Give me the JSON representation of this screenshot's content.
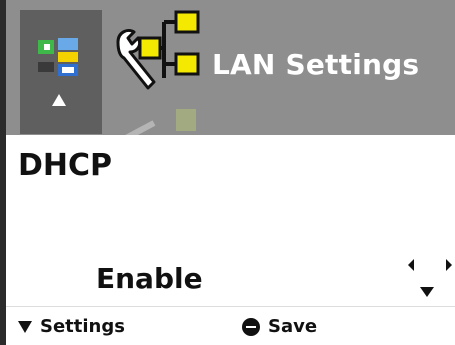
{
  "header": {
    "title": "LAN Settings",
    "icon": "lan-network-icon",
    "sidebar_icon": "network-menu-icon"
  },
  "field": {
    "title": "DHCP",
    "value": "Enable"
  },
  "footer": {
    "left_label": "Settings",
    "middle_label": "Save"
  },
  "colors": {
    "header_bg": "#8e8e8e",
    "header_selected": "#5f5f5f",
    "icon_yellow": "#f4e900",
    "text": "#111111"
  }
}
